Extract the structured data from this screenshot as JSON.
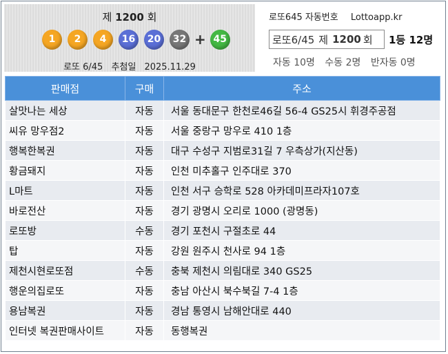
{
  "draw": {
    "round_prefix": "제",
    "round_number": "1200",
    "round_suffix": "회",
    "numbers": [
      "1",
      "2",
      "4",
      "16",
      "20",
      "32"
    ],
    "number_colors": [
      "#f5a623",
      "#f5a623",
      "#f5a623",
      "#5b6fd6",
      "#5b6fd6",
      "#777777"
    ],
    "plus": "+",
    "bonus": "45",
    "bonus_color": "#44b844",
    "game_name": "로또 6/45",
    "date_label": "추첨일",
    "date": "2025.11.29"
  },
  "info": {
    "title": "로또645 자동번호",
    "site": "Lottoapp.kr",
    "round_game": "로또6/45",
    "round_prefix": "제",
    "round_number": "1200",
    "round_suffix": "회",
    "first_prize_label": "1등 12명",
    "auto_count": "자동 10명",
    "manual_count": "수동 2명",
    "semi_auto_count": "반자동 0명"
  },
  "table": {
    "headers": [
      "판매점",
      "구매",
      "주소"
    ],
    "rows": [
      [
        "살맛나는 세상",
        "자동",
        "서울 동대문구 한천로46길 56-4 GS25시 휘경주공점"
      ],
      [
        "씨유 망우점2",
        "자동",
        "서울 중랑구 망우로 410 1층"
      ],
      [
        "행복한복권",
        "자동",
        "대구 수성구 지범로31길 7 우측상가(지산동)"
      ],
      [
        "황금돼지",
        "자동",
        "인천 미추홀구 인주대로 370"
      ],
      [
        "L마트",
        "자동",
        "인천 서구 승학로 528 아카데미프라자107호"
      ],
      [
        "바로전산",
        "자동",
        "경기 광명시 오리로 1000 (광명동)"
      ],
      [
        "로또방",
        "수동",
        "경기 포천시 구절초로 44"
      ],
      [
        "탑",
        "자동",
        "강원 원주시 천사로 94 1층"
      ],
      [
        "제천시현로또점",
        "수동",
        "충북 제천시 의림대로 340 GS25"
      ],
      [
        "행운의집로또",
        "자동",
        "충남 아산시 북수북길 7-4 1층"
      ],
      [
        "용남복권",
        "자동",
        "경남 통영시 남해안대로 440"
      ],
      [
        "인터넷 복권판매사이트",
        "자동",
        "동행복권"
      ]
    ]
  }
}
